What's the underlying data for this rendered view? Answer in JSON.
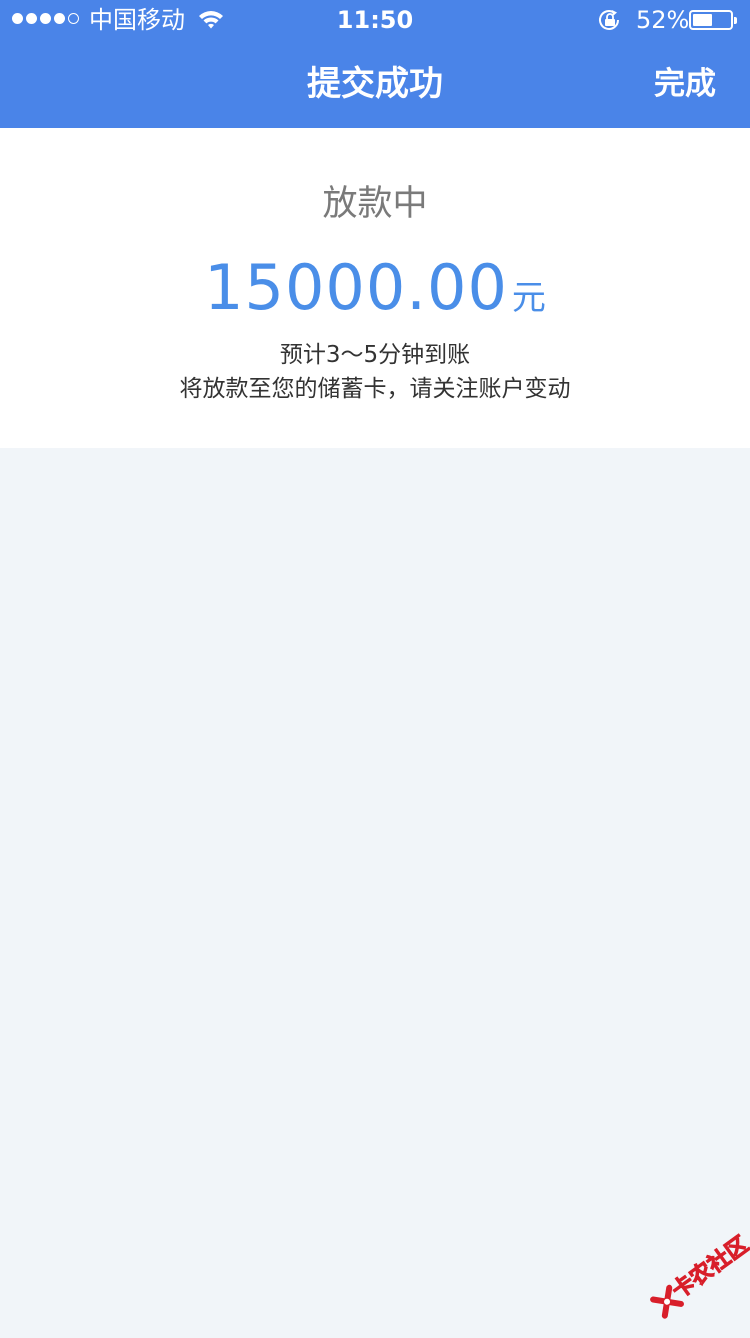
{
  "status_bar": {
    "carrier": "中国移动",
    "time": "11:50",
    "battery_percent_text": "52%",
    "battery_level": 0.52,
    "signal_bars_filled": 4,
    "signal_bars_total": 5,
    "icons": [
      "signal-dots-icon",
      "wifi-icon",
      "rotation-lock-icon",
      "battery-icon"
    ]
  },
  "nav": {
    "title": "提交成功",
    "done_label": "完成"
  },
  "result": {
    "status": "放款中",
    "amount": "15000.00",
    "unit": "元",
    "eta": "预计3～5分钟到账",
    "note": "将放款至您的储蓄卡，请关注账户变动"
  },
  "watermark": {
    "text": "卡农社区"
  },
  "colors": {
    "nav_bg": "#4a84e8",
    "amount": "#4a8ee8",
    "page_bg": "#f1f5f9",
    "watermark_red": "#d81e2a"
  }
}
